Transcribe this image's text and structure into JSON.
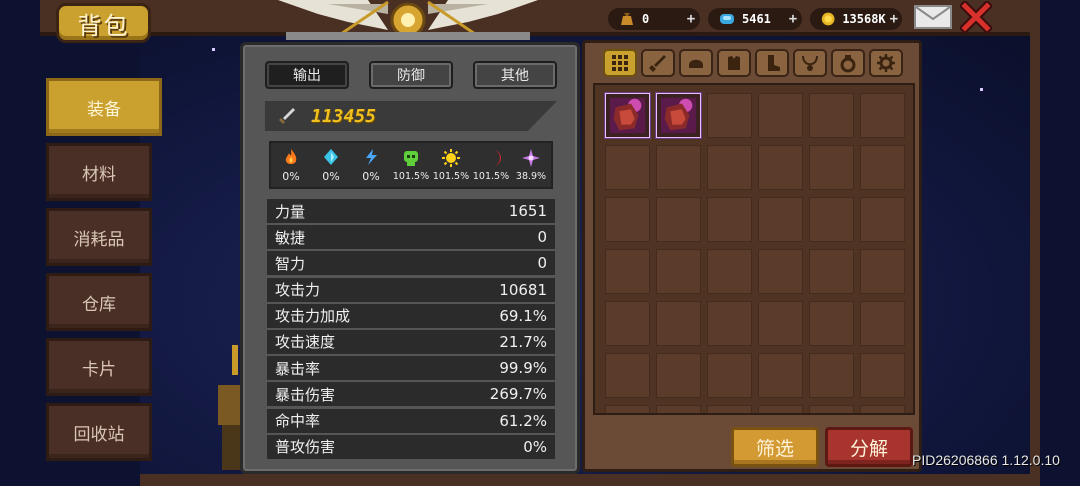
{
  "title": "背包",
  "currency": [
    {
      "icon": "gold-bag-icon",
      "value": "0",
      "plus": "+"
    },
    {
      "icon": "blue-gem-icon",
      "value": "5461",
      "plus": "+"
    },
    {
      "icon": "gold-coin-icon",
      "value": "13568K",
      "plus": "+"
    }
  ],
  "sidebar": {
    "items": [
      {
        "label": "装备",
        "active": true
      },
      {
        "label": "材料"
      },
      {
        "label": "消耗品"
      },
      {
        "label": "仓库"
      },
      {
        "label": "卡片"
      },
      {
        "label": "回收站"
      }
    ]
  },
  "stats": {
    "tabs": [
      {
        "label": "输出",
        "active": true
      },
      {
        "label": "防御"
      },
      {
        "label": "其他"
      }
    ],
    "power": "113455",
    "elements": [
      {
        "icon": "fire-icon",
        "value": "0%",
        "color": "#ff7a1a"
      },
      {
        "icon": "ice-crystal-icon",
        "value": "0%",
        "color": "#3ac4e8"
      },
      {
        "icon": "lightning-icon",
        "value": "0%",
        "color": "#4aa8ff"
      },
      {
        "icon": "poison-skull-icon",
        "value": "101.5%",
        "color": "#5ecf3a"
      },
      {
        "icon": "sun-icon",
        "value": "101.5%",
        "color": "#ffd21a"
      },
      {
        "icon": "dark-moon-icon",
        "value": "101.5%",
        "color": "#c8282e"
      },
      {
        "icon": "arcane-star-icon",
        "value": "38.9%",
        "color": "#c87ae8"
      }
    ],
    "rows": [
      {
        "label": "力量",
        "value": "1651"
      },
      {
        "label": "敏捷",
        "value": "0"
      },
      {
        "label": "智力",
        "value": "0"
      },
      {
        "label": "攻击力",
        "value": "10681"
      },
      {
        "label": "攻击力加成",
        "value": "69.1%"
      },
      {
        "label": "攻击速度",
        "value": "21.7%"
      },
      {
        "label": "暴击率",
        "value": "99.9%"
      },
      {
        "label": "暴击伤害",
        "value": "269.7%"
      },
      {
        "label": "命中率",
        "value": "61.2%"
      },
      {
        "label": "普攻伤害",
        "value": "0%"
      }
    ]
  },
  "inventory": {
    "categories": [
      "grid-all-icon",
      "sword-icon",
      "helmet-icon",
      "chest-armor-icon",
      "boots-icon",
      "necklace-icon",
      "ring-icon",
      "gear-icon"
    ],
    "filled_slots": 2,
    "filter_label": "筛选",
    "decompose_label": "分解"
  },
  "version": "PID26206866 1.12.0.10",
  "colors": {
    "accent_gold": "#caa12e",
    "danger_red": "#a8342e",
    "panel_gray": "#565656",
    "wood_brown": "#6b4a36"
  }
}
